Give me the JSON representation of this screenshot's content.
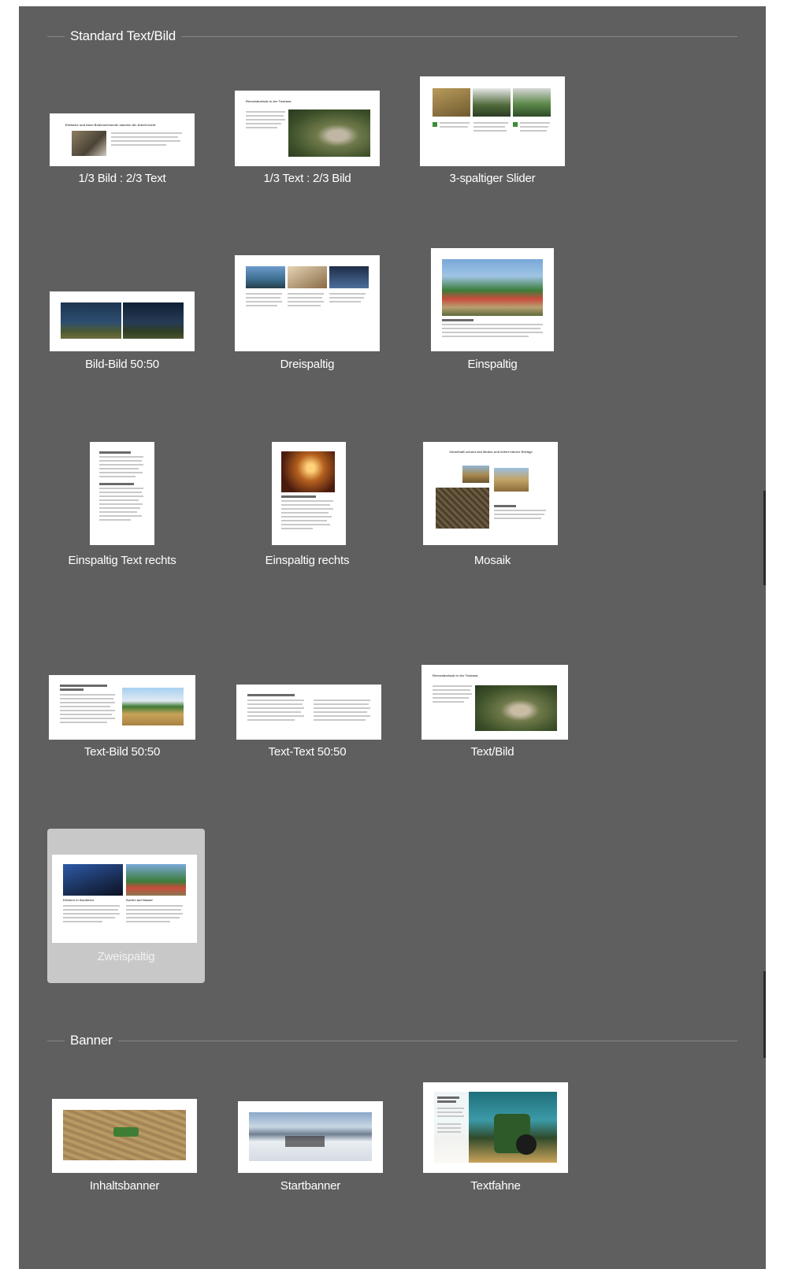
{
  "sections": {
    "standard": {
      "title": "Standard Text/Bild"
    },
    "banner": {
      "title": "Banner"
    }
  },
  "templates": [
    {
      "label": "1/3 Bild : 2/3 Text"
    },
    {
      "label": "1/3 Text : 2/3 Bild"
    },
    {
      "label": "3-spaltiger Slider"
    },
    {
      "label": "Bild-Bild 50:50"
    },
    {
      "label": "Dreispaltig"
    },
    {
      "label": "Einspaltig"
    },
    {
      "label": "Einspaltig Text rechts"
    },
    {
      "label": "Einspaltig rechts"
    },
    {
      "label": "Mosaik"
    },
    {
      "label": "Text-Bild 50:50"
    },
    {
      "label": "Text-Text 50:50"
    },
    {
      "label": "Text/Bild"
    },
    {
      "label": "Zweispaltig",
      "selected": true
    }
  ],
  "banners": [
    {
      "label": "Inhaltsbanner"
    },
    {
      "label": "Startbanner"
    },
    {
      "label": "Textfahne"
    }
  ],
  "thumb_text": {
    "t1_heading": "Einfache und klare Bedienelemente machen die Arbeit leicht",
    "t2_heading": "Rennradurlaub in der Toskana",
    "t9_heading": "Vorteilhaft schont den Boden und liefert höhere Erträge",
    "t12_heading": "Rennradurlaub in der Toskana",
    "t13_col1": "Klettern in Sardinien",
    "t13_col2": "Surfen auf Hawaii"
  },
  "colors": {
    "panel": "#5f5f5f",
    "divider": "#878787",
    "selected_tile": "#c8c8c8",
    "label": "#ffffff"
  }
}
